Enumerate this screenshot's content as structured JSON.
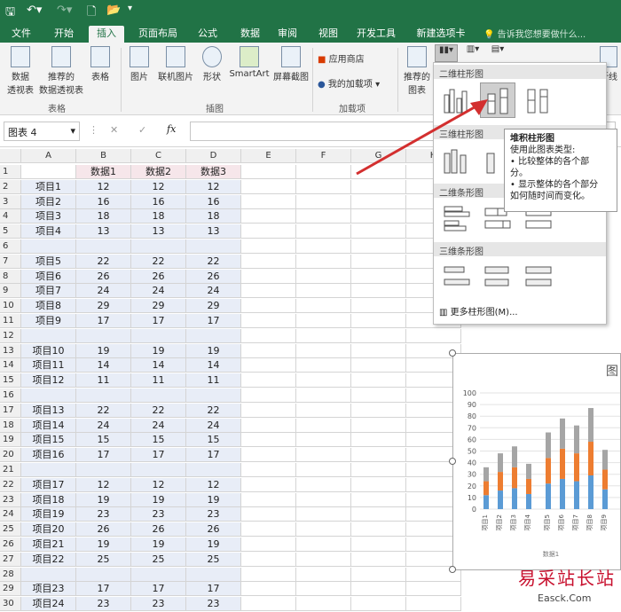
{
  "qat": {
    "save_icon": "save-icon",
    "undo_icon": "undo-icon",
    "redo_icon": "redo-icon",
    "new_icon": "new-doc-icon",
    "open_icon": "open-icon"
  },
  "tabs": [
    "文件",
    "开始",
    "插入",
    "页面布局",
    "公式",
    "数据",
    "审阅",
    "视图",
    "开发工具",
    "新建选项卡"
  ],
  "active_tab": "插入",
  "tell_me": "告诉我您想要做什么...",
  "ribbon": {
    "tables": {
      "pivot": "数据\n透视表",
      "rec_pivot": "推荐的\n数据透视表",
      "table": "表格",
      "label": "表格"
    },
    "illustrations": {
      "picture": "图片",
      "online_picture": "联机图片",
      "shapes": "形状",
      "smartart": "SmartArt",
      "screenshot": "屏幕截图",
      "label": "插图"
    },
    "addins": {
      "store": "应用商店",
      "my_addins": "我的加载项",
      "label": "加载项"
    },
    "charts": {
      "recommended": "推荐的\n图表",
      "line": "折线"
    }
  },
  "name_box": "图表 4",
  "columns": [
    "A",
    "B",
    "C",
    "D",
    "E",
    "F",
    "G",
    "H"
  ],
  "header_row": [
    "",
    "数据1",
    "数据2",
    "数据3"
  ],
  "rows": [
    [
      "项目1",
      "12",
      "12",
      "12"
    ],
    [
      "项目2",
      "16",
      "16",
      "16"
    ],
    [
      "项目3",
      "18",
      "18",
      "18"
    ],
    [
      "项目4",
      "13",
      "13",
      "13"
    ],
    [
      "",
      "",
      "",
      ""
    ],
    [
      "项目5",
      "22",
      "22",
      "22"
    ],
    [
      "项目6",
      "26",
      "26",
      "26"
    ],
    [
      "项目7",
      "24",
      "24",
      "24"
    ],
    [
      "项目8",
      "29",
      "29",
      "29"
    ],
    [
      "项目9",
      "17",
      "17",
      "17"
    ],
    [
      "",
      "",
      "",
      ""
    ],
    [
      "项目10",
      "19",
      "19",
      "19"
    ],
    [
      "项目11",
      "14",
      "14",
      "14"
    ],
    [
      "项目12",
      "11",
      "11",
      "11"
    ],
    [
      "",
      "",
      "",
      ""
    ],
    [
      "项目13",
      "22",
      "22",
      "22"
    ],
    [
      "项目14",
      "24",
      "24",
      "24"
    ],
    [
      "项目15",
      "15",
      "15",
      "15"
    ],
    [
      "项目16",
      "17",
      "17",
      "17"
    ],
    [
      "",
      "",
      "",
      ""
    ],
    [
      "项目17",
      "12",
      "12",
      "12"
    ],
    [
      "项目18",
      "19",
      "19",
      "19"
    ],
    [
      "项目19",
      "23",
      "23",
      "23"
    ],
    [
      "项目20",
      "26",
      "26",
      "26"
    ],
    [
      "项目21",
      "19",
      "19",
      "19"
    ],
    [
      "项目22",
      "25",
      "25",
      "25"
    ],
    [
      "",
      "",
      "",
      ""
    ],
    [
      "项目23",
      "17",
      "17",
      "17"
    ],
    [
      "项目24",
      "23",
      "23",
      "23"
    ]
  ],
  "gallery": {
    "sec_2d_column": "二维柱形图",
    "sec_3d_column": "三维柱形图",
    "sec_2d_bar": "二维条形图",
    "sec_3d_bar": "三维条形图",
    "more": "更多柱形图(M)..."
  },
  "tooltip": {
    "title": "堆积柱形图",
    "line1": "使用此图表类型:",
    "line2": "• 比较整体的各个部",
    "line3": "分。",
    "line4": "• 显示整体的各个部分",
    "line5": "如何随时间而变化。"
  },
  "chart_data": {
    "type": "bar",
    "stacked": true,
    "title": "图",
    "categories": [
      "项目1",
      "项目2",
      "项目3",
      "项目4",
      "项目5",
      "项目6",
      "项目7",
      "项目8",
      "项目9",
      "项目10"
    ],
    "series": [
      {
        "values": [
          12,
          16,
          18,
          13,
          22,
          26,
          24,
          29,
          17,
          19
        ],
        "color": "#5b9bd5"
      },
      {
        "values": [
          12,
          16,
          18,
          13,
          22,
          26,
          24,
          29,
          17,
          19
        ],
        "color": "#ed7d31"
      },
      {
        "values": [
          12,
          16,
          18,
          13,
          22,
          26,
          24,
          29,
          17,
          19
        ],
        "color": "#a5a5a5"
      }
    ],
    "yticks": [
      "0",
      "10",
      "20",
      "30",
      "40",
      "50",
      "60",
      "70",
      "80",
      "90",
      "100"
    ],
    "ylim": [
      0,
      100
    ],
    "xlabel": "数据1",
    "grid": true
  },
  "watermark": {
    "text": "易采站长站",
    "sub": "Easck.Com"
  },
  "colors": {
    "excel_green": "#217346",
    "arrow": "#d32f2f"
  }
}
